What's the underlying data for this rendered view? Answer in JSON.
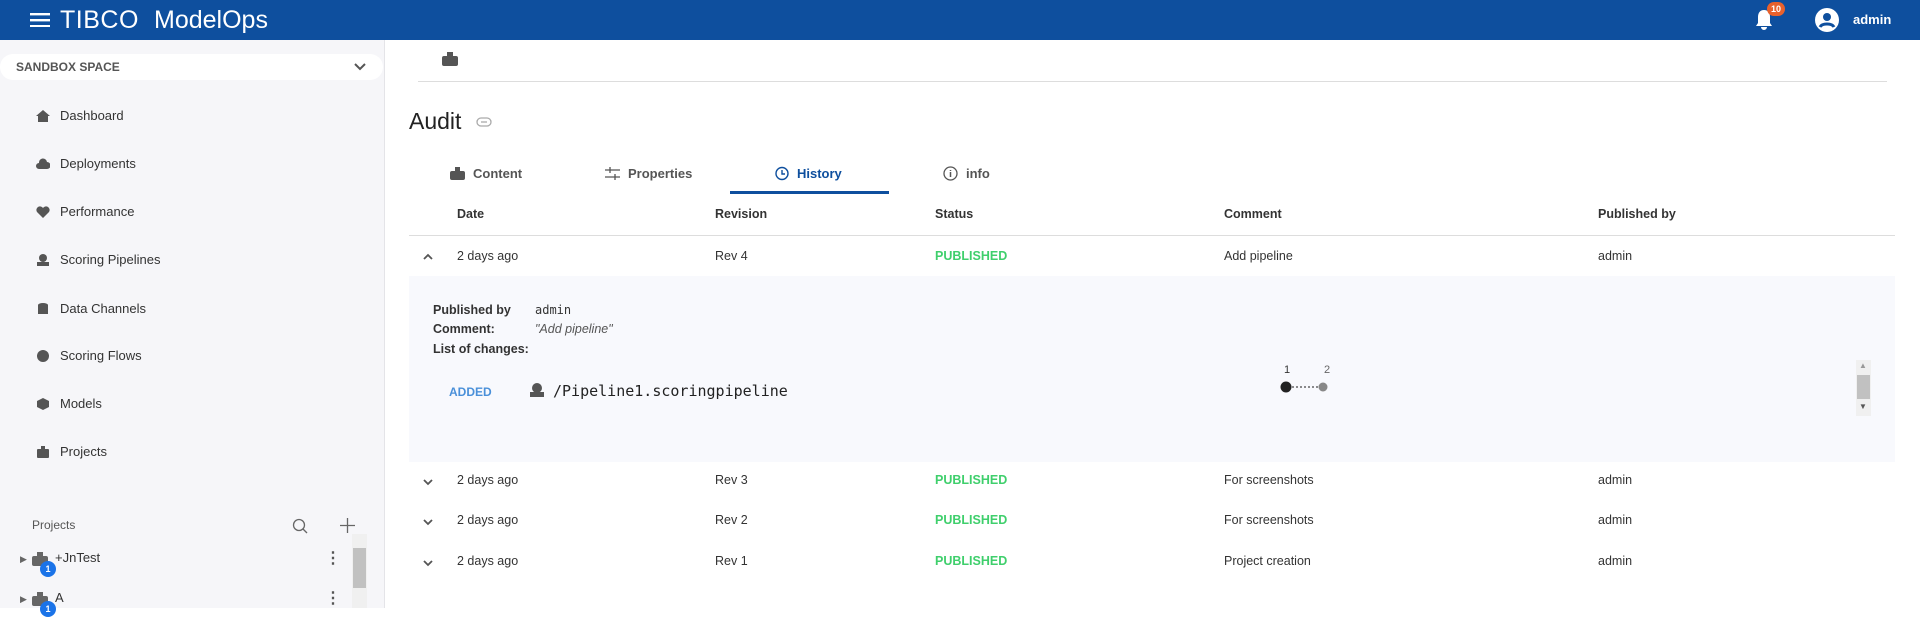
{
  "header": {
    "brand": "TIBCO",
    "product": "ModelOps",
    "notification_count": "10",
    "user": "admin",
    "accent": "#0e4f9e"
  },
  "sidebar": {
    "space": "SANDBOX SPACE",
    "items": [
      {
        "label": "Dashboard",
        "icon": "home-icon"
      },
      {
        "label": "Deployments",
        "icon": "cloud-upload-icon"
      },
      {
        "label": "Performance",
        "icon": "heart-pulse-icon"
      },
      {
        "label": "Scoring Pipelines",
        "icon": "pipeline-icon"
      },
      {
        "label": "Data Channels",
        "icon": "database-icon"
      },
      {
        "label": "Scoring Flows",
        "icon": "gauge-icon"
      },
      {
        "label": "Models",
        "icon": "cube-icon"
      },
      {
        "label": "Projects",
        "icon": "briefcase-icon"
      }
    ],
    "projects_label": "Projects",
    "projects": [
      {
        "name": "+JnTest",
        "badge": "1"
      },
      {
        "name": "A",
        "badge": "1"
      }
    ]
  },
  "main": {
    "title": "Audit",
    "tabs": [
      {
        "label": "Content"
      },
      {
        "label": "Properties"
      },
      {
        "label": "History",
        "active": true
      },
      {
        "label": "info"
      }
    ],
    "columns": [
      "Date",
      "Revision",
      "Status",
      "Comment",
      "Published by"
    ],
    "rows": [
      {
        "date": "2 days ago",
        "revision": "Rev 4",
        "status": "PUBLISHED",
        "comment": "Add pipeline",
        "published_by": "admin",
        "expanded": true
      },
      {
        "date": "2 days ago",
        "revision": "Rev 3",
        "status": "PUBLISHED",
        "comment": "For screenshots",
        "published_by": "admin"
      },
      {
        "date": "2 days ago",
        "revision": "Rev 2",
        "status": "PUBLISHED",
        "comment": "For screenshots",
        "published_by": "admin"
      },
      {
        "date": "2 days ago",
        "revision": "Rev 1",
        "status": "PUBLISHED",
        "comment": "Project creation",
        "published_by": "admin"
      }
    ],
    "detail": {
      "published_by_label": "Published by",
      "published_by": "admin",
      "comment_label": "Comment:",
      "comment": "\"Add pipeline\"",
      "changes_label": "List of changes:",
      "change": {
        "type": "ADDED",
        "path": "/Pipeline1.scoringpipeline"
      },
      "timeline": [
        "1",
        "2"
      ]
    }
  }
}
